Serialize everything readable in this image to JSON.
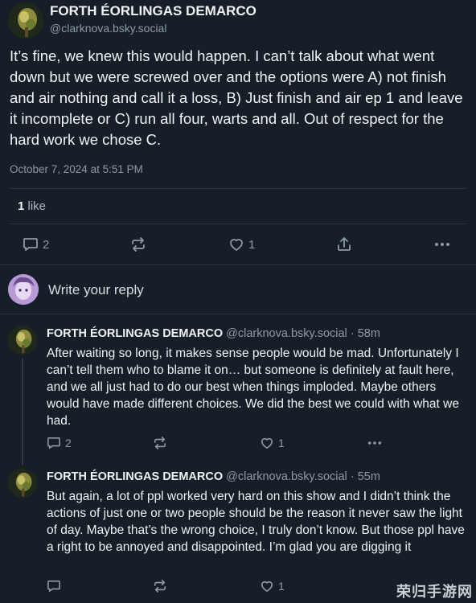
{
  "main_post": {
    "author_name": "FORTH ÉORLINGAS DEMARCO",
    "author_handle": "@clarknova.bsky.social",
    "text": "It’s fine, we knew this would happen. I can’t talk about what went down but we were screwed over and the options were A) not finish and air nothing and call it a loss, B) Just finish and air ep 1 and leave it incomplete or C) run all four, warts and all. Out of respect for the hard work we chose C.",
    "timestamp": "October 7, 2024 at 5:51 PM",
    "like_count": "1",
    "like_label": "like",
    "actions": {
      "reply_count": "2",
      "like_count": "1",
      "icons": [
        "reply-icon",
        "repost-icon",
        "like-icon",
        "share-icon",
        "more-icon"
      ]
    }
  },
  "composer": {
    "placeholder": "Write your reply"
  },
  "replies": [
    {
      "author_name": "FORTH ÉORLINGAS DEMARCO",
      "author_handle": "@clarknova.bsky.social",
      "separator": "·",
      "time": "58m",
      "text": "After waiting so long, it makes sense people would be mad. Unfortunately I can’t tell them who to blame it on… but someone is definitely at fault here, and we all just had to do our best when things imploded. Maybe others would have made different choices. We did the best we could with what we had.",
      "reply_count": "2",
      "like_count": "1"
    },
    {
      "author_name": "FORTH ÉORLINGAS DEMARCO",
      "author_handle": "@clarknova.bsky.social",
      "separator": "·",
      "time": "55m",
      "text": "But again, a lot of ppl worked very hard on this show and I didn’t think the actions of just one or two people should be the reason it never saw the light of day. Maybe that’s the wrong choice, I truly don’t know. But those ppl have a right to be annoyed and disappointed. I’m glad you are digging it",
      "reply_count": "",
      "like_count": "1"
    }
  ],
  "watermark": "荣归手游网",
  "colors": {
    "background": "#161e27",
    "text": "#f1f3f5",
    "muted": "#8f9aa8",
    "divider": "#2b3644"
  }
}
